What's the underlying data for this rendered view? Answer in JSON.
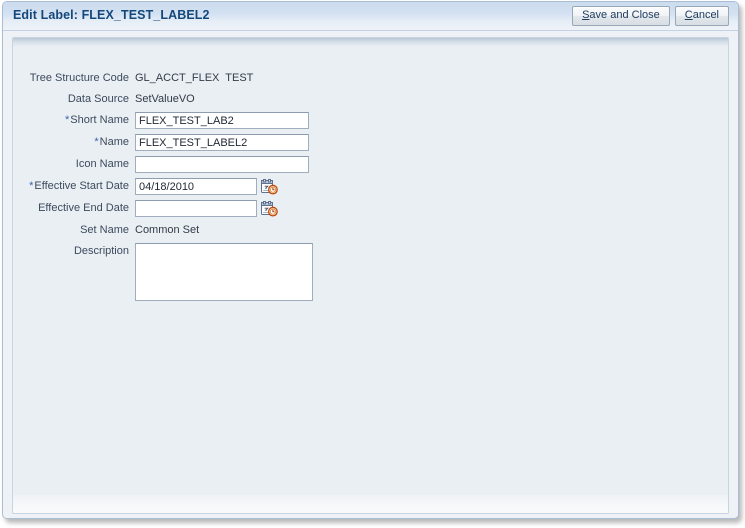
{
  "dialog": {
    "title": "Edit Label: FLEX_TEST_LABEL2",
    "save_label_accel": "S",
    "save_label_rest": "ave and Close",
    "cancel_label_accel": "C",
    "cancel_label_rest": "ancel"
  },
  "colors": {
    "titlebar_top": "#cbdcee",
    "title_text": "#14487a",
    "panel_bg": "#eaeff4",
    "required_asterisk": "#3a63a8",
    "input_border": "#9fadbd",
    "icon_clock": "#cf4a16"
  },
  "form": {
    "tree_structure_code": {
      "label": "Tree Structure Code",
      "value": "GL_ACCT_FLEX  TEST"
    },
    "data_source": {
      "label": "Data Source",
      "value": "SetValueVO"
    },
    "short_name": {
      "label": "Short Name",
      "required": "*",
      "value": "FLEX_TEST_LAB2",
      "placeholder": ""
    },
    "name": {
      "label": "Name",
      "required": "*",
      "value": "FLEX_TEST_LABEL2",
      "placeholder": ""
    },
    "icon_name": {
      "label": "Icon Name",
      "value": "",
      "placeholder": ""
    },
    "effective_start_date": {
      "label": "Effective Start Date",
      "required": "*",
      "value": "04/18/2010",
      "placeholder": "",
      "picker_icon": "calendar-clock-icon"
    },
    "effective_end_date": {
      "label": "Effective End Date",
      "value": "",
      "placeholder": "",
      "picker_icon": "calendar-clock-icon"
    },
    "set_name": {
      "label": "Set Name",
      "value": "Common Set"
    },
    "description": {
      "label": "Description",
      "value": "",
      "placeholder": ""
    }
  }
}
